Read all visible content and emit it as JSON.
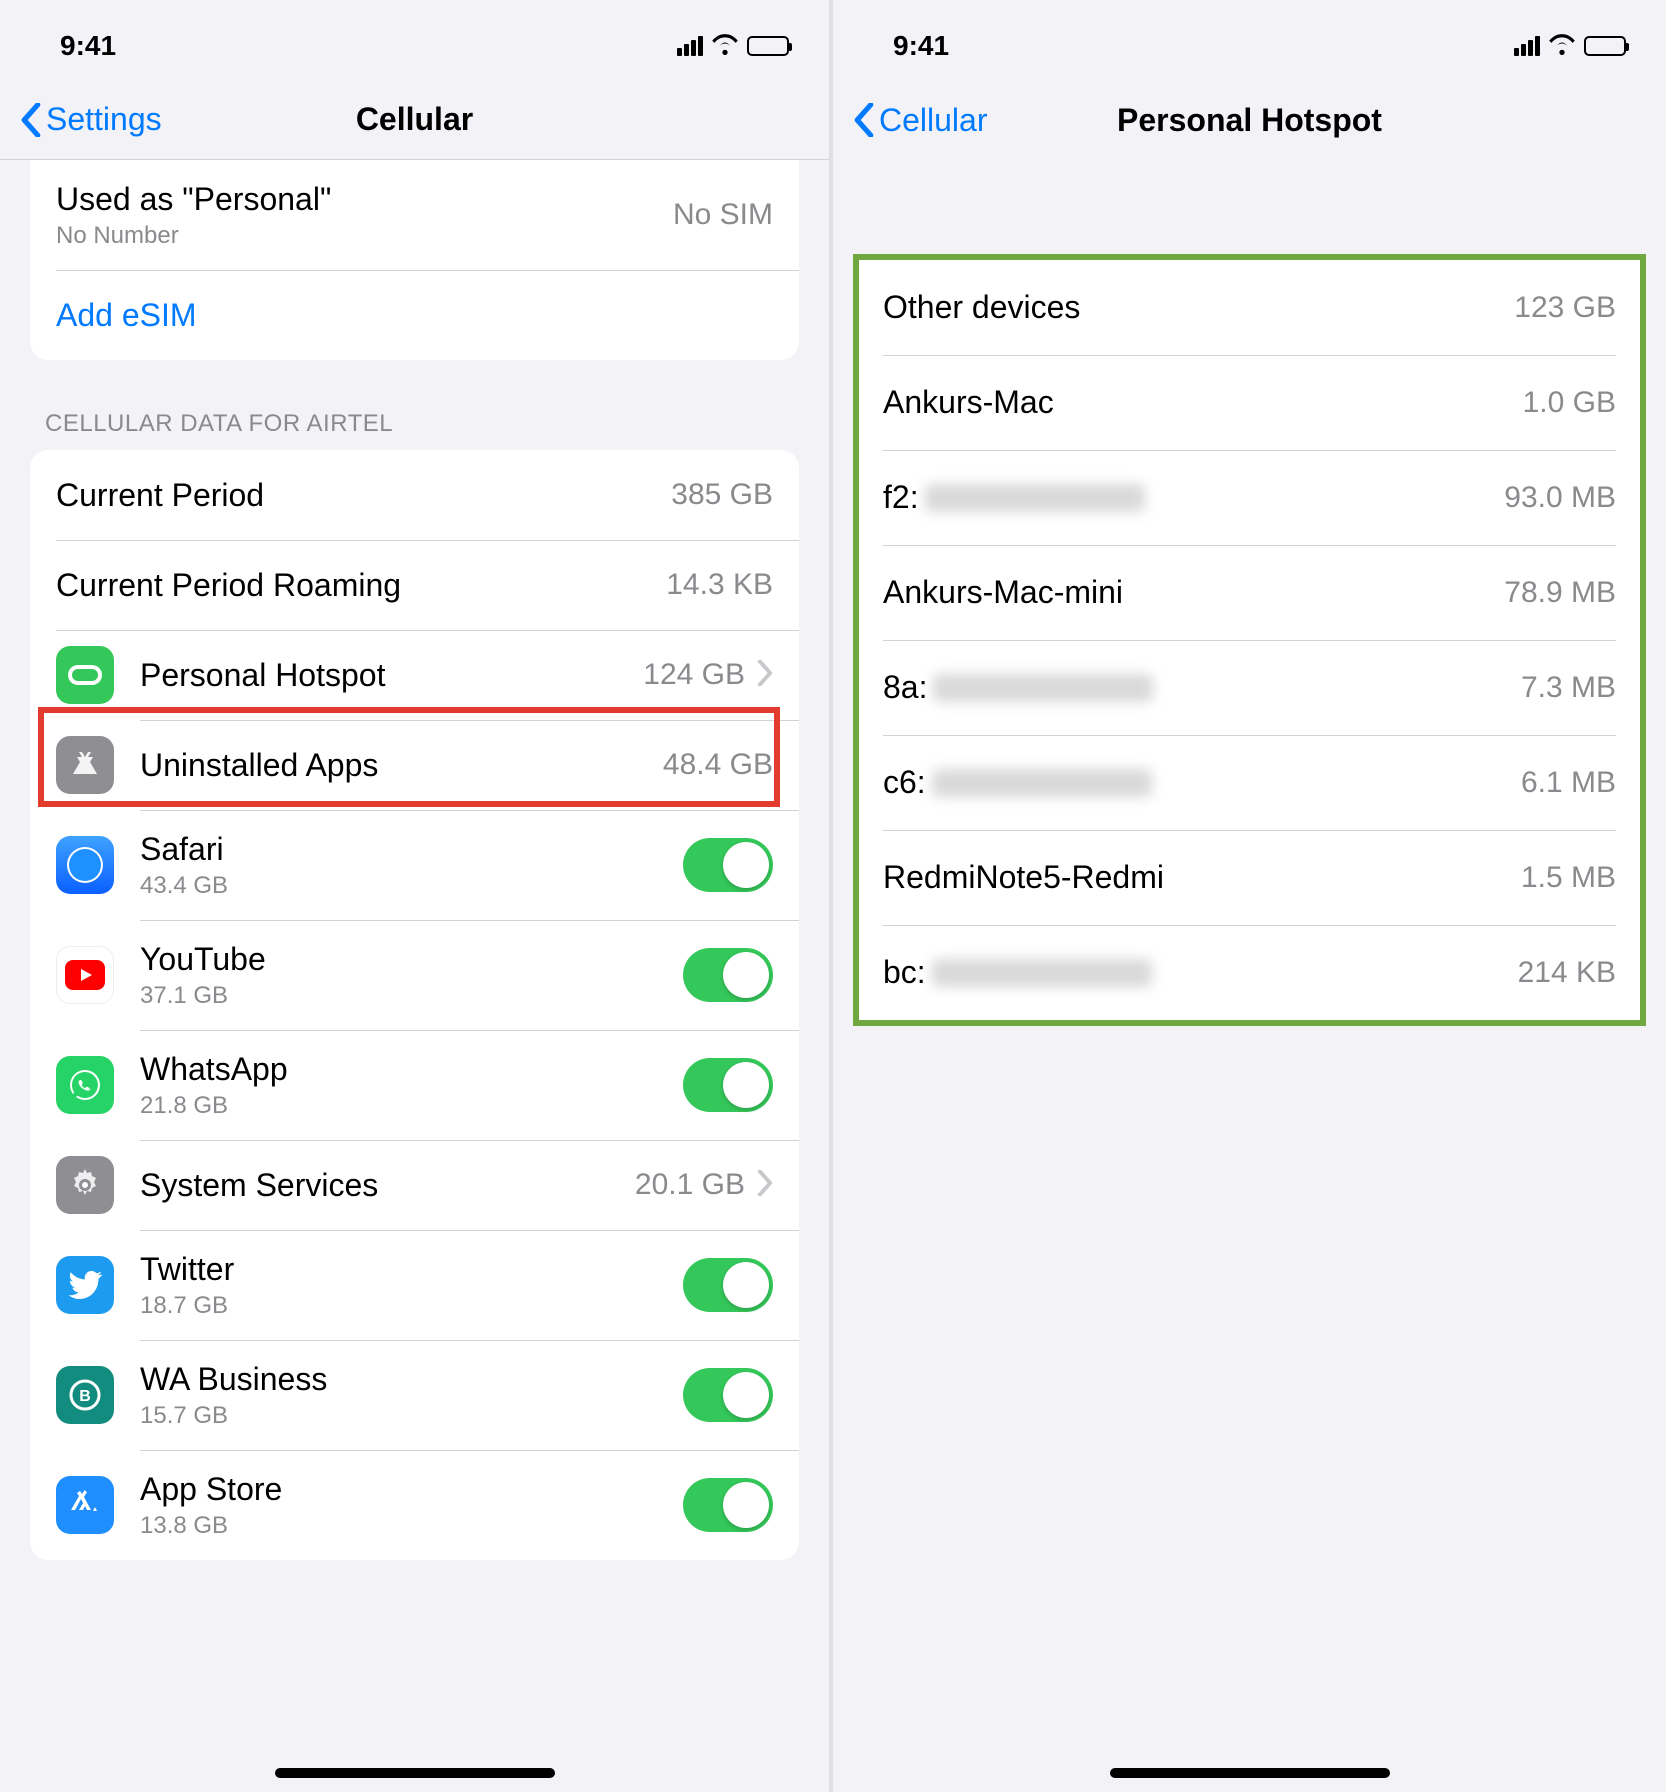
{
  "status": {
    "time": "9:41"
  },
  "left": {
    "back": "Settings",
    "title": "Cellular",
    "sim": {
      "used_as": "Used as \"Personal\"",
      "no_number": "No Number",
      "no_sim": "No SIM",
      "add_esim": "Add eSIM"
    },
    "section_header": "CELLULAR DATA FOR AIRTEL",
    "rows": {
      "current_period": {
        "label": "Current Period",
        "value": "385 GB"
      },
      "current_period_roaming": {
        "label": "Current Period Roaming",
        "value": "14.3 KB"
      },
      "personal_hotspot": {
        "label": "Personal Hotspot",
        "value": "124 GB"
      },
      "uninstalled_apps": {
        "label": "Uninstalled Apps",
        "value": "48.4 GB"
      },
      "safari": {
        "label": "Safari",
        "sub": "43.4 GB"
      },
      "youtube": {
        "label": "YouTube",
        "sub": "37.1 GB"
      },
      "whatsapp": {
        "label": "WhatsApp",
        "sub": "21.8 GB"
      },
      "system_services": {
        "label": "System Services",
        "value": "20.1 GB"
      },
      "twitter": {
        "label": "Twitter",
        "sub": "18.7 GB"
      },
      "wa_business": {
        "label": "WA Business",
        "sub": "15.7 GB"
      },
      "app_store": {
        "label": "App Store",
        "sub": "13.8 GB"
      }
    }
  },
  "right": {
    "back": "Cellular",
    "title": "Personal Hotspot",
    "devices": [
      {
        "name": "Other devices",
        "value": "123 GB"
      },
      {
        "name": "Ankurs-Mac",
        "value": "1.0 GB"
      },
      {
        "name": "f2:",
        "value": "93.0 MB",
        "blurred": true
      },
      {
        "name": "Ankurs-Mac-mini",
        "value": "78.9 MB"
      },
      {
        "name": "8a:",
        "value": "7.3 MB",
        "blurred": true
      },
      {
        "name": "c6:",
        "value": "6.1 MB",
        "blurred": true
      },
      {
        "name": "RedmiNote5-Redmi",
        "value": "1.5 MB"
      },
      {
        "name": "bc:",
        "value": "214 KB",
        "blurred": true
      }
    ]
  }
}
